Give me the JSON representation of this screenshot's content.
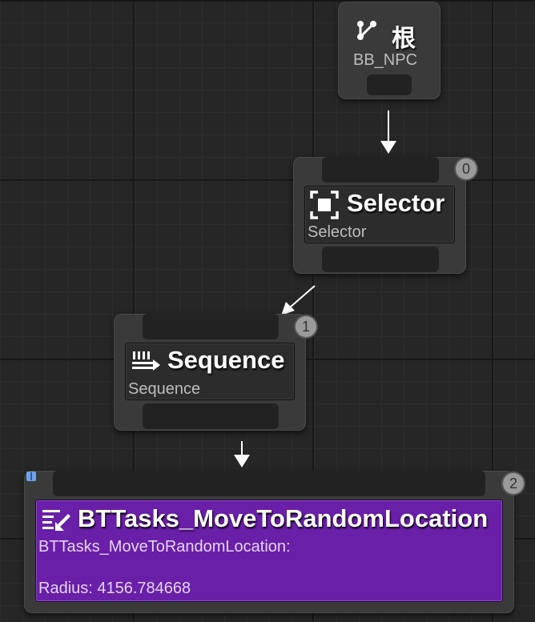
{
  "root_node": {
    "title": "根",
    "subtitle": "BB_NPC"
  },
  "selector_node": {
    "title": "Selector",
    "subtitle": "Selector",
    "order": "0"
  },
  "sequence_node": {
    "title": "Sequence",
    "subtitle": "Sequence",
    "order": "1"
  },
  "task_node": {
    "title": "BTTasks_MoveToRandomLocation",
    "subtitle": "BTTasks_MoveToRandomLocation:",
    "property": "Radius: 4156.784668",
    "order": "2",
    "color": "#6a1fa8"
  },
  "colors": {
    "background": "#262626",
    "node": "#3a3a3a",
    "task": "#6a1fa8"
  },
  "icons": [
    "branch-icon",
    "selector-icon",
    "sequence-icon",
    "task-icon",
    "breakpoint-icon"
  ]
}
